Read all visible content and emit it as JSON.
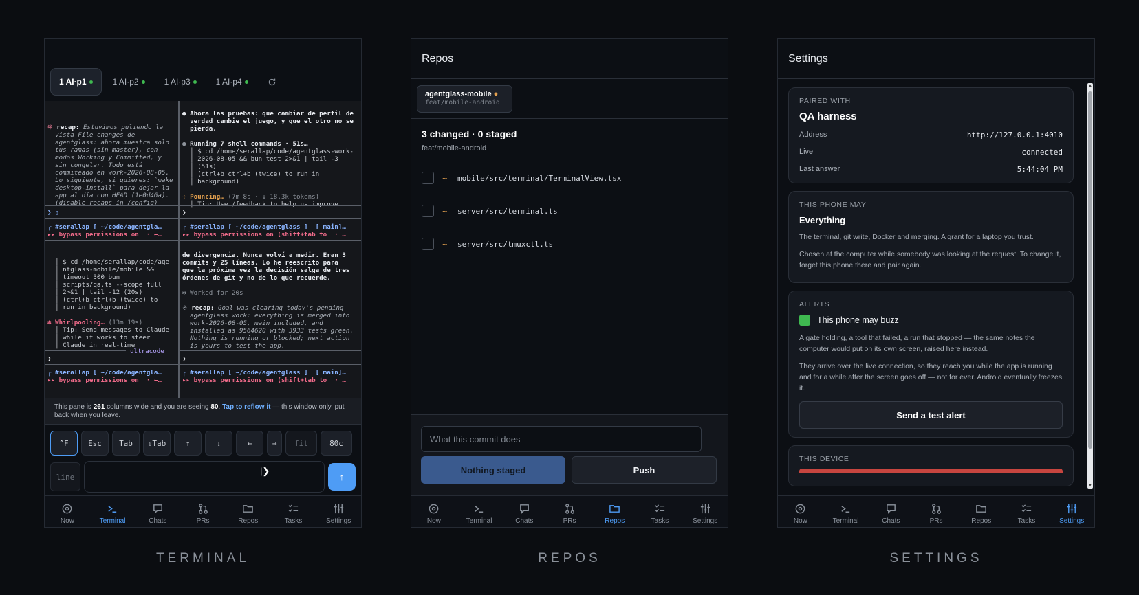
{
  "captions": {
    "terminal": "TERMINAL",
    "repos": "REPOS",
    "settings": "SETTINGS"
  },
  "nav": [
    "Now",
    "Terminal",
    "Chats",
    "PRs",
    "Repos",
    "Tasks",
    "Settings"
  ],
  "terminal": {
    "tabs": [
      "1 AI·p1",
      "1 AI·p2",
      "1 AI·p3",
      "1 AI·p4"
    ],
    "notice": {
      "pre": "This pane is ",
      "cols": "261",
      "mid": " columns wide and you are seeing ",
      "seen": "80",
      "dot": ". ",
      "link": "Tap to reflow it",
      "post": " — this window only, put back when you leave."
    },
    "keys": [
      "^F",
      "Esc",
      "Tab",
      "⇧Tab",
      "↑",
      "↓",
      "←",
      "→",
      "fit",
      "80c"
    ],
    "line_label": "line",
    "send": "↑",
    "panes": {
      "tl": {
        "l1a": "※ ",
        "l1b": "recap:",
        "l1c": " Estuvimos puliendo la",
        "l2": "  vista File changes de",
        "l3": "  agentglass: ahora muestra solo",
        "l4": "  tus ramas (sin master), con",
        "l5": "  modos Working y Committed, y",
        "l6": "  sin congelar. Todo está",
        "l7": "  commiteado en work-2026-08-05.",
        "l8": "  Lo siguiente, si quieres: `make",
        "l9": "  desktop-install` para dejar la",
        "l10": "  app al día con HEAD (1e0d46a).",
        "l11": "  (disable recaps in /config)",
        "prompt": "❯ ▯"
      },
      "tr": {
        "l1": "● Ahora las pruebas: que cambiar de perfil de",
        "l2": "  verdad cambie el juego, y que el otro no se",
        "l3": "  pierda.",
        "l4a": "● ",
        "l4b": "Running 7 shell commands · 51s…",
        "l5": "  │ $ cd /home/serallap/code/agentglass-work-",
        "l6": "  │ 2026-08-05 && bun test 2>&1 | tail -3",
        "l7": "  │ (51s)",
        "l8": "  │ (ctrl+b ctrl+b (twice) to run in",
        "l9": "  │ background)",
        "l10a": "✢ ",
        "l10b": "Pouncing…",
        "l10c": " (7m 8s · ↓ 18.3k tokens)",
        "l11": "  │ Tip: Use /feedback to help us improve!",
        "prompt": "❯"
      },
      "status": {
        "left1": "╭ #serallap [ ~/code/agentgla…",
        "left2": "▸▸ bypass permissions on  · ←…",
        "right1": "╭ #serallap [ ~/code/agentglass ]  [ main]…",
        "right2": "▸▸ bypass permissions on (shift+tab to  · …"
      },
      "bl": {
        "l1": "  │ $ cd /home/serallap/code/age",
        "l2": "  │ ntglass-mobile/mobile &&",
        "l3": "  │ timeout 300 bun",
        "l4": "  │ scripts/qa.ts --scope full",
        "l5": "  │ 2>&1 | tail -12 (20s)",
        "l6": "  │ (ctrl+b ctrl+b (twice) to",
        "l7": "  │ run in background)",
        "l8a": "✽ ",
        "l8b": "Whirlpooling…",
        "l8c": " (13m 19s)",
        "l9": "  │ Tip: Send messages to Claude",
        "l10": "  │ while it works to steer",
        "l11": "  │ Claude in real-time",
        "ultra": "ultracode",
        "prompt": "❯"
      },
      "br": {
        "l1": "de divergencia. Nunca volví a medir. Eran 3",
        "l2": "commits y 25 líneas. Lo he reescrito para",
        "l3": "que la próxima vez la decisión salga de tres",
        "l4": "órdenes de git y no de lo que recuerde.",
        "l5": "✻ Worked for 20s",
        "l6a": "※ ",
        "l6b": "recap:",
        "l6c": " Goal was clearing today's pending",
        "l7": "  agentglass work: everything is merged into",
        "l8": "  work-2026-08-05, main included, and",
        "l9": "  installed as 9564620 with 3933 tests green.",
        "l10": "  Nothing is running or blocked; next action",
        "l11": "  is yours to test the app.",
        "prompt": "❯"
      }
    }
  },
  "repos": {
    "title": "Repos",
    "chip": {
      "name": "agentglass-mobile",
      "branch": "feat/mobile-android"
    },
    "summary": "3 changed · 0 staged",
    "branch": "feat/mobile-android",
    "files": [
      {
        "mark": "~",
        "path": "mobile/src/terminal/TerminalView.tsx"
      },
      {
        "mark": "~",
        "path": "server/src/terminal.ts"
      },
      {
        "mark": "~",
        "path": "server/src/tmuxctl.ts"
      }
    ],
    "commit_placeholder": "What this commit does",
    "staged_btn": "Nothing staged",
    "push_btn": "Push"
  },
  "settings": {
    "title": "Settings",
    "paired": {
      "label": "PAIRED WITH",
      "name": "QA harness",
      "rows": [
        {
          "k": "Address",
          "v": "http://127.0.0.1:4010"
        },
        {
          "k": "Live",
          "v": "connected"
        },
        {
          "k": "Last answer",
          "v": "5:44:04 PM"
        }
      ]
    },
    "phone": {
      "label": "THIS PHONE MAY",
      "title": "Everything",
      "p1": "The terminal, git write, Docker and merging. A grant for a laptop you trust.",
      "p2": "Chosen at the computer while somebody was looking at the request. To change it, forget this phone there and pair again."
    },
    "alerts": {
      "label": "ALERTS",
      "toggle": "This phone may buzz",
      "p1": "A gate holding, a tool that failed, a run that stopped — the same notes the computer would put on its own screen, raised here instead.",
      "p2": "They arrive over the live connection, so they reach you while the app is running and for a while after the screen goes off — not for ever. Android eventually freezes it.",
      "btn": "Send a test alert"
    },
    "device": {
      "label": "THIS DEVICE"
    }
  },
  "colors": {
    "accent": "#4e9cf5",
    "green": "#3fb950",
    "orange": "#e3a04f",
    "pink": "#f06b8a"
  }
}
